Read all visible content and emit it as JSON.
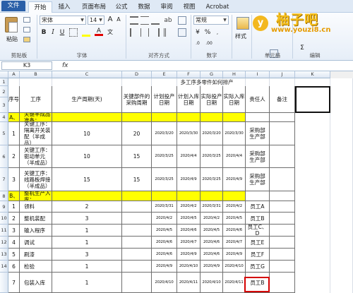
{
  "ribbon": {
    "tabs": [
      "文件",
      "开始",
      "插入",
      "页面布局",
      "公式",
      "数据",
      "审阅",
      "视图",
      "Acrobat"
    ],
    "active_tab": "开始",
    "paste_label": "粘贴",
    "font_name": "宋体",
    "font_size": "14",
    "number_format": "常规",
    "style_label": "样式",
    "groups": [
      "剪贴板",
      "字体",
      "对齐方式",
      "数字",
      "单元格",
      "编辑"
    ],
    "icons": [
      "cut-icon",
      "copy-icon",
      "format-painter-icon",
      "bold-icon",
      "italic-icon",
      "underline-icon",
      "border-icon",
      "fill-color-icon",
      "font-color-icon",
      "wrap-text-icon",
      "merge-icon",
      "currency-icon",
      "percent-icon",
      "conditional-format-icon",
      "insert-icon",
      "delete-icon",
      "format-icon",
      "autosum-icon",
      "sort-filter-icon"
    ]
  },
  "watermark": {
    "logo_letter": "y",
    "name": "柚子吧",
    "url": "www.youzi8.cn"
  },
  "formula_bar": {
    "name_box": "K3",
    "fx": "fx",
    "content": ""
  },
  "columns": [
    "A",
    "B",
    "C",
    "D",
    "E",
    "F",
    "G",
    "H",
    "I",
    "J",
    "K"
  ],
  "row_numbers": [
    "1",
    "2",
    "3",
    "4",
    "5",
    "6",
    "7",
    "8",
    "9",
    "10",
    "11",
    "12",
    "13",
    "14"
  ],
  "sheet": {
    "title": "多工序多零件如何排产",
    "headers": [
      "序号",
      "工序",
      "生产周期(天)",
      "关键部件的采购周期",
      "计划投产日期",
      "计划入库日期",
      "实际投产日期",
      "实际入库日期",
      "责任人",
      "备注"
    ],
    "section_a": {
      "code": "A、",
      "label": "关键半成品准备："
    },
    "section_b": {
      "code": "B、",
      "label": "整机生产入库："
    },
    "rows_a": [
      {
        "no": "1",
        "process": "关键工序：隔离开关装配（半成品）",
        "cycle": "10",
        "purchase": "20",
        "plan_start": "2020/3/20",
        "plan_in": "2020/3/30",
        "act_start": "2020/3/20",
        "act_in": "2020/3/30",
        "owner": "采购部\n生产部"
      },
      {
        "no": "2",
        "process": "关键工序：驱动单元（半成品）",
        "cycle": "10",
        "purchase": "15",
        "plan_start": "2020/3/25",
        "plan_in": "2020/4/4",
        "act_start": "2020/3/25",
        "act_in": "2020/4/4",
        "owner": "采购部\n生产部"
      },
      {
        "no": "3",
        "process": "关键工序：线路板焊接（半成品）",
        "cycle": "15",
        "purchase": "15",
        "plan_start": "2020/3/25",
        "plan_in": "2020/4/9",
        "act_start": "2020/3/25",
        "act_in": "2020/4/9",
        "owner": "采购部\n生产部"
      }
    ],
    "rows_b": [
      {
        "no": "1",
        "process": "领料",
        "cycle": "2",
        "plan_start": "2020/3/31",
        "plan_in": "2020/4/2",
        "act_start": "2020/3/31",
        "act_in": "2020/4/2",
        "owner": "员工A"
      },
      {
        "no": "2",
        "process": "整机装配",
        "cycle": "3",
        "plan_start": "2020/4/2",
        "plan_in": "2020/4/5",
        "act_start": "2020/4/2",
        "act_in": "2020/4/5",
        "owner": "员工B"
      },
      {
        "no": "3",
        "process": "输入程序",
        "cycle": "1",
        "plan_start": "2020/4/5",
        "plan_in": "2020/4/6",
        "act_start": "2020/4/5",
        "act_in": "2020/4/6",
        "owner": "员工C、D"
      },
      {
        "no": "4",
        "process": "调试",
        "cycle": "1",
        "plan_start": "2020/4/6",
        "plan_in": "2020/4/7",
        "act_start": "2020/4/6",
        "act_in": "2020/4/7",
        "owner": "员工E"
      },
      {
        "no": "5",
        "process": "刷漆",
        "cycle": "3",
        "plan_start": "2020/4/6",
        "plan_in": "2020/4/9",
        "act_start": "2020/4/6",
        "act_in": "2020/4/9",
        "owner": "员工F"
      },
      {
        "no": "6",
        "process": "检验",
        "cycle": "1",
        "plan_start": "2020/4/9",
        "plan_in": "2020/4/10",
        "act_start": "2020/4/9",
        "act_in": "2020/4/10",
        "owner": "员工G"
      },
      {
        "no": "7",
        "process": "包装入库",
        "cycle": "1",
        "plan_start": "2020/4/10",
        "plan_in": "2020/4/11",
        "act_start": "2020/4/10",
        "act_in": "2020/4/11",
        "owner": "员工B"
      }
    ]
  }
}
